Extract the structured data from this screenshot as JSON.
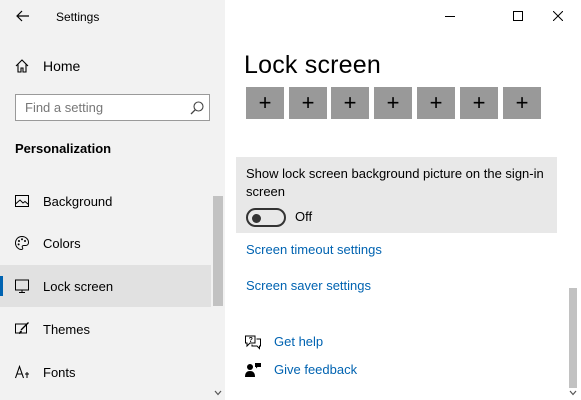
{
  "window": {
    "title": "Settings",
    "minimize_icon": "minimize-icon",
    "maximize_icon": "maximize-icon",
    "close_icon": "close-icon"
  },
  "sidebar": {
    "home_label": "Home",
    "search_placeholder": "Find a setting",
    "section_title": "Personalization",
    "items": [
      {
        "label": "Background",
        "icon": "picture-icon",
        "selected": false
      },
      {
        "label": "Colors",
        "icon": "palette-icon",
        "selected": false
      },
      {
        "label": "Lock screen",
        "icon": "lock-screen-icon",
        "selected": true
      },
      {
        "label": "Themes",
        "icon": "brush-icon",
        "selected": false
      },
      {
        "label": "Fonts",
        "icon": "font-icon",
        "selected": false
      }
    ]
  },
  "main": {
    "title": "Lock screen",
    "app_tiles": [
      "+",
      "+",
      "+",
      "+",
      "+",
      "+",
      "+"
    ],
    "sign_in_setting": {
      "label": "Show lock screen background picture on the sign-in screen",
      "toggle_on": false,
      "state_label": "Off"
    },
    "links": {
      "screen_timeout": "Screen timeout settings",
      "screen_saver": "Screen saver settings"
    },
    "help": {
      "get_help": "Get help",
      "give_feedback": "Give feedback"
    }
  },
  "colors": {
    "accent": "#0063b1",
    "sidebar_bg": "#f2f2f2",
    "selected_bg": "#e1e1e1",
    "tile_bg": "#999999",
    "card_bg": "#e8e8e8"
  }
}
